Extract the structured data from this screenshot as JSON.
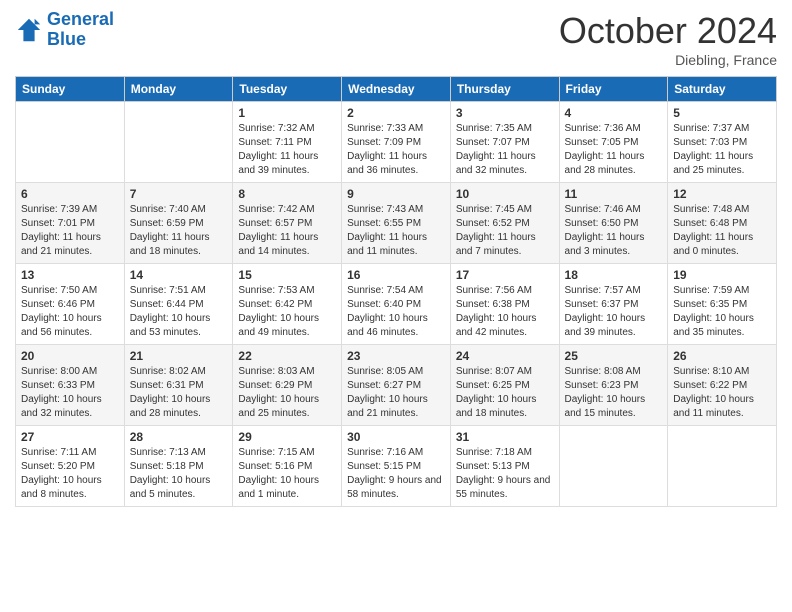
{
  "logo": {
    "line1": "General",
    "line2": "Blue"
  },
  "title": "October 2024",
  "subtitle": "Diebling, France",
  "days_header": [
    "Sunday",
    "Monday",
    "Tuesday",
    "Wednesday",
    "Thursday",
    "Friday",
    "Saturday"
  ],
  "weeks": [
    [
      {
        "day": "",
        "sunrise": "",
        "sunset": "",
        "daylight": ""
      },
      {
        "day": "",
        "sunrise": "",
        "sunset": "",
        "daylight": ""
      },
      {
        "day": "1",
        "sunrise": "Sunrise: 7:32 AM",
        "sunset": "Sunset: 7:11 PM",
        "daylight": "Daylight: 11 hours and 39 minutes."
      },
      {
        "day": "2",
        "sunrise": "Sunrise: 7:33 AM",
        "sunset": "Sunset: 7:09 PM",
        "daylight": "Daylight: 11 hours and 36 minutes."
      },
      {
        "day": "3",
        "sunrise": "Sunrise: 7:35 AM",
        "sunset": "Sunset: 7:07 PM",
        "daylight": "Daylight: 11 hours and 32 minutes."
      },
      {
        "day": "4",
        "sunrise": "Sunrise: 7:36 AM",
        "sunset": "Sunset: 7:05 PM",
        "daylight": "Daylight: 11 hours and 28 minutes."
      },
      {
        "day": "5",
        "sunrise": "Sunrise: 7:37 AM",
        "sunset": "Sunset: 7:03 PM",
        "daylight": "Daylight: 11 hours and 25 minutes."
      }
    ],
    [
      {
        "day": "6",
        "sunrise": "Sunrise: 7:39 AM",
        "sunset": "Sunset: 7:01 PM",
        "daylight": "Daylight: 11 hours and 21 minutes."
      },
      {
        "day": "7",
        "sunrise": "Sunrise: 7:40 AM",
        "sunset": "Sunset: 6:59 PM",
        "daylight": "Daylight: 11 hours and 18 minutes."
      },
      {
        "day": "8",
        "sunrise": "Sunrise: 7:42 AM",
        "sunset": "Sunset: 6:57 PM",
        "daylight": "Daylight: 11 hours and 14 minutes."
      },
      {
        "day": "9",
        "sunrise": "Sunrise: 7:43 AM",
        "sunset": "Sunset: 6:55 PM",
        "daylight": "Daylight: 11 hours and 11 minutes."
      },
      {
        "day": "10",
        "sunrise": "Sunrise: 7:45 AM",
        "sunset": "Sunset: 6:52 PM",
        "daylight": "Daylight: 11 hours and 7 minutes."
      },
      {
        "day": "11",
        "sunrise": "Sunrise: 7:46 AM",
        "sunset": "Sunset: 6:50 PM",
        "daylight": "Daylight: 11 hours and 3 minutes."
      },
      {
        "day": "12",
        "sunrise": "Sunrise: 7:48 AM",
        "sunset": "Sunset: 6:48 PM",
        "daylight": "Daylight: 11 hours and 0 minutes."
      }
    ],
    [
      {
        "day": "13",
        "sunrise": "Sunrise: 7:50 AM",
        "sunset": "Sunset: 6:46 PM",
        "daylight": "Daylight: 10 hours and 56 minutes."
      },
      {
        "day": "14",
        "sunrise": "Sunrise: 7:51 AM",
        "sunset": "Sunset: 6:44 PM",
        "daylight": "Daylight: 10 hours and 53 minutes."
      },
      {
        "day": "15",
        "sunrise": "Sunrise: 7:53 AM",
        "sunset": "Sunset: 6:42 PM",
        "daylight": "Daylight: 10 hours and 49 minutes."
      },
      {
        "day": "16",
        "sunrise": "Sunrise: 7:54 AM",
        "sunset": "Sunset: 6:40 PM",
        "daylight": "Daylight: 10 hours and 46 minutes."
      },
      {
        "day": "17",
        "sunrise": "Sunrise: 7:56 AM",
        "sunset": "Sunset: 6:38 PM",
        "daylight": "Daylight: 10 hours and 42 minutes."
      },
      {
        "day": "18",
        "sunrise": "Sunrise: 7:57 AM",
        "sunset": "Sunset: 6:37 PM",
        "daylight": "Daylight: 10 hours and 39 minutes."
      },
      {
        "day": "19",
        "sunrise": "Sunrise: 7:59 AM",
        "sunset": "Sunset: 6:35 PM",
        "daylight": "Daylight: 10 hours and 35 minutes."
      }
    ],
    [
      {
        "day": "20",
        "sunrise": "Sunrise: 8:00 AM",
        "sunset": "Sunset: 6:33 PM",
        "daylight": "Daylight: 10 hours and 32 minutes."
      },
      {
        "day": "21",
        "sunrise": "Sunrise: 8:02 AM",
        "sunset": "Sunset: 6:31 PM",
        "daylight": "Daylight: 10 hours and 28 minutes."
      },
      {
        "day": "22",
        "sunrise": "Sunrise: 8:03 AM",
        "sunset": "Sunset: 6:29 PM",
        "daylight": "Daylight: 10 hours and 25 minutes."
      },
      {
        "day": "23",
        "sunrise": "Sunrise: 8:05 AM",
        "sunset": "Sunset: 6:27 PM",
        "daylight": "Daylight: 10 hours and 21 minutes."
      },
      {
        "day": "24",
        "sunrise": "Sunrise: 8:07 AM",
        "sunset": "Sunset: 6:25 PM",
        "daylight": "Daylight: 10 hours and 18 minutes."
      },
      {
        "day": "25",
        "sunrise": "Sunrise: 8:08 AM",
        "sunset": "Sunset: 6:23 PM",
        "daylight": "Daylight: 10 hours and 15 minutes."
      },
      {
        "day": "26",
        "sunrise": "Sunrise: 8:10 AM",
        "sunset": "Sunset: 6:22 PM",
        "daylight": "Daylight: 10 hours and 11 minutes."
      }
    ],
    [
      {
        "day": "27",
        "sunrise": "Sunrise: 7:11 AM",
        "sunset": "Sunset: 5:20 PM",
        "daylight": "Daylight: 10 hours and 8 minutes."
      },
      {
        "day": "28",
        "sunrise": "Sunrise: 7:13 AM",
        "sunset": "Sunset: 5:18 PM",
        "daylight": "Daylight: 10 hours and 5 minutes."
      },
      {
        "day": "29",
        "sunrise": "Sunrise: 7:15 AM",
        "sunset": "Sunset: 5:16 PM",
        "daylight": "Daylight: 10 hours and 1 minute."
      },
      {
        "day": "30",
        "sunrise": "Sunrise: 7:16 AM",
        "sunset": "Sunset: 5:15 PM",
        "daylight": "Daylight: 9 hours and 58 minutes."
      },
      {
        "day": "31",
        "sunrise": "Sunrise: 7:18 AM",
        "sunset": "Sunset: 5:13 PM",
        "daylight": "Daylight: 9 hours and 55 minutes."
      },
      {
        "day": "",
        "sunrise": "",
        "sunset": "",
        "daylight": ""
      },
      {
        "day": "",
        "sunrise": "",
        "sunset": "",
        "daylight": ""
      }
    ]
  ]
}
